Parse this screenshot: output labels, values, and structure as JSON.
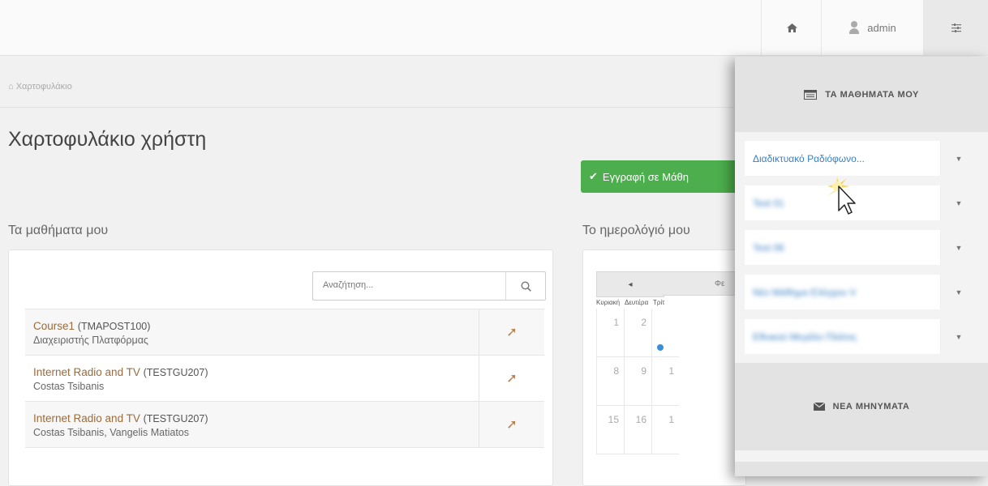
{
  "topbar": {
    "home_icon": "home-icon",
    "username": "admin",
    "menu_icon": "sliders-icon"
  },
  "breadcrumb": {
    "text": "Χαρτοφυλάκιο"
  },
  "page": {
    "title": "Χαρτοφυλάκιο χρήστη"
  },
  "enroll_button": {
    "label": "Εγγραφή σε Μάθη"
  },
  "courses": {
    "heading": "Τα μαθήματα μου",
    "search_placeholder": "Αναζήτηση...",
    "rows": [
      {
        "name": "Course1",
        "code": "(TMAPOST100)",
        "teacher": "Διαχειριστής Πλατφόρμας"
      },
      {
        "name": "Internet Radio and TV",
        "code": "(TESTGU207)",
        "teacher": "Costas Tsibanis"
      },
      {
        "name": "Internet Radio and TV",
        "code": "(TESTGU207)",
        "teacher": "Costas Tsibanis, Vangelis Matiatos"
      }
    ]
  },
  "calendar": {
    "heading": "Το ημερολόγιό μου",
    "prev_label": "◂",
    "month_label": "Φε",
    "weekdays": [
      "Κυριακή",
      "Δευτέρα",
      "Τρίτ"
    ],
    "weeks": [
      [
        "1",
        "2",
        ""
      ],
      [
        "8",
        "9",
        "1"
      ],
      [
        "15",
        "16",
        "1"
      ]
    ]
  },
  "side_panel": {
    "my_courses_label": "ΤΑ ΜΑΘΗΜΑΤΑ ΜΟΥ",
    "items": [
      {
        "label": "Διαδικτυακό Ραδιόφωνο..."
      },
      {
        "label": "Test 01"
      },
      {
        "label": "Test 06"
      },
      {
        "label": "Νέο Μάθημα Ελέγχου V"
      },
      {
        "label": "Εθνικού Μεγάλο Πλάτος"
      }
    ],
    "messages_label": "ΝΕΑ ΜΗΝΥΜΑΤΑ"
  },
  "colors": {
    "accent_green": "#4cae4c",
    "link_blue": "#3a7fc4",
    "course_brown": "#9a6b3c"
  }
}
